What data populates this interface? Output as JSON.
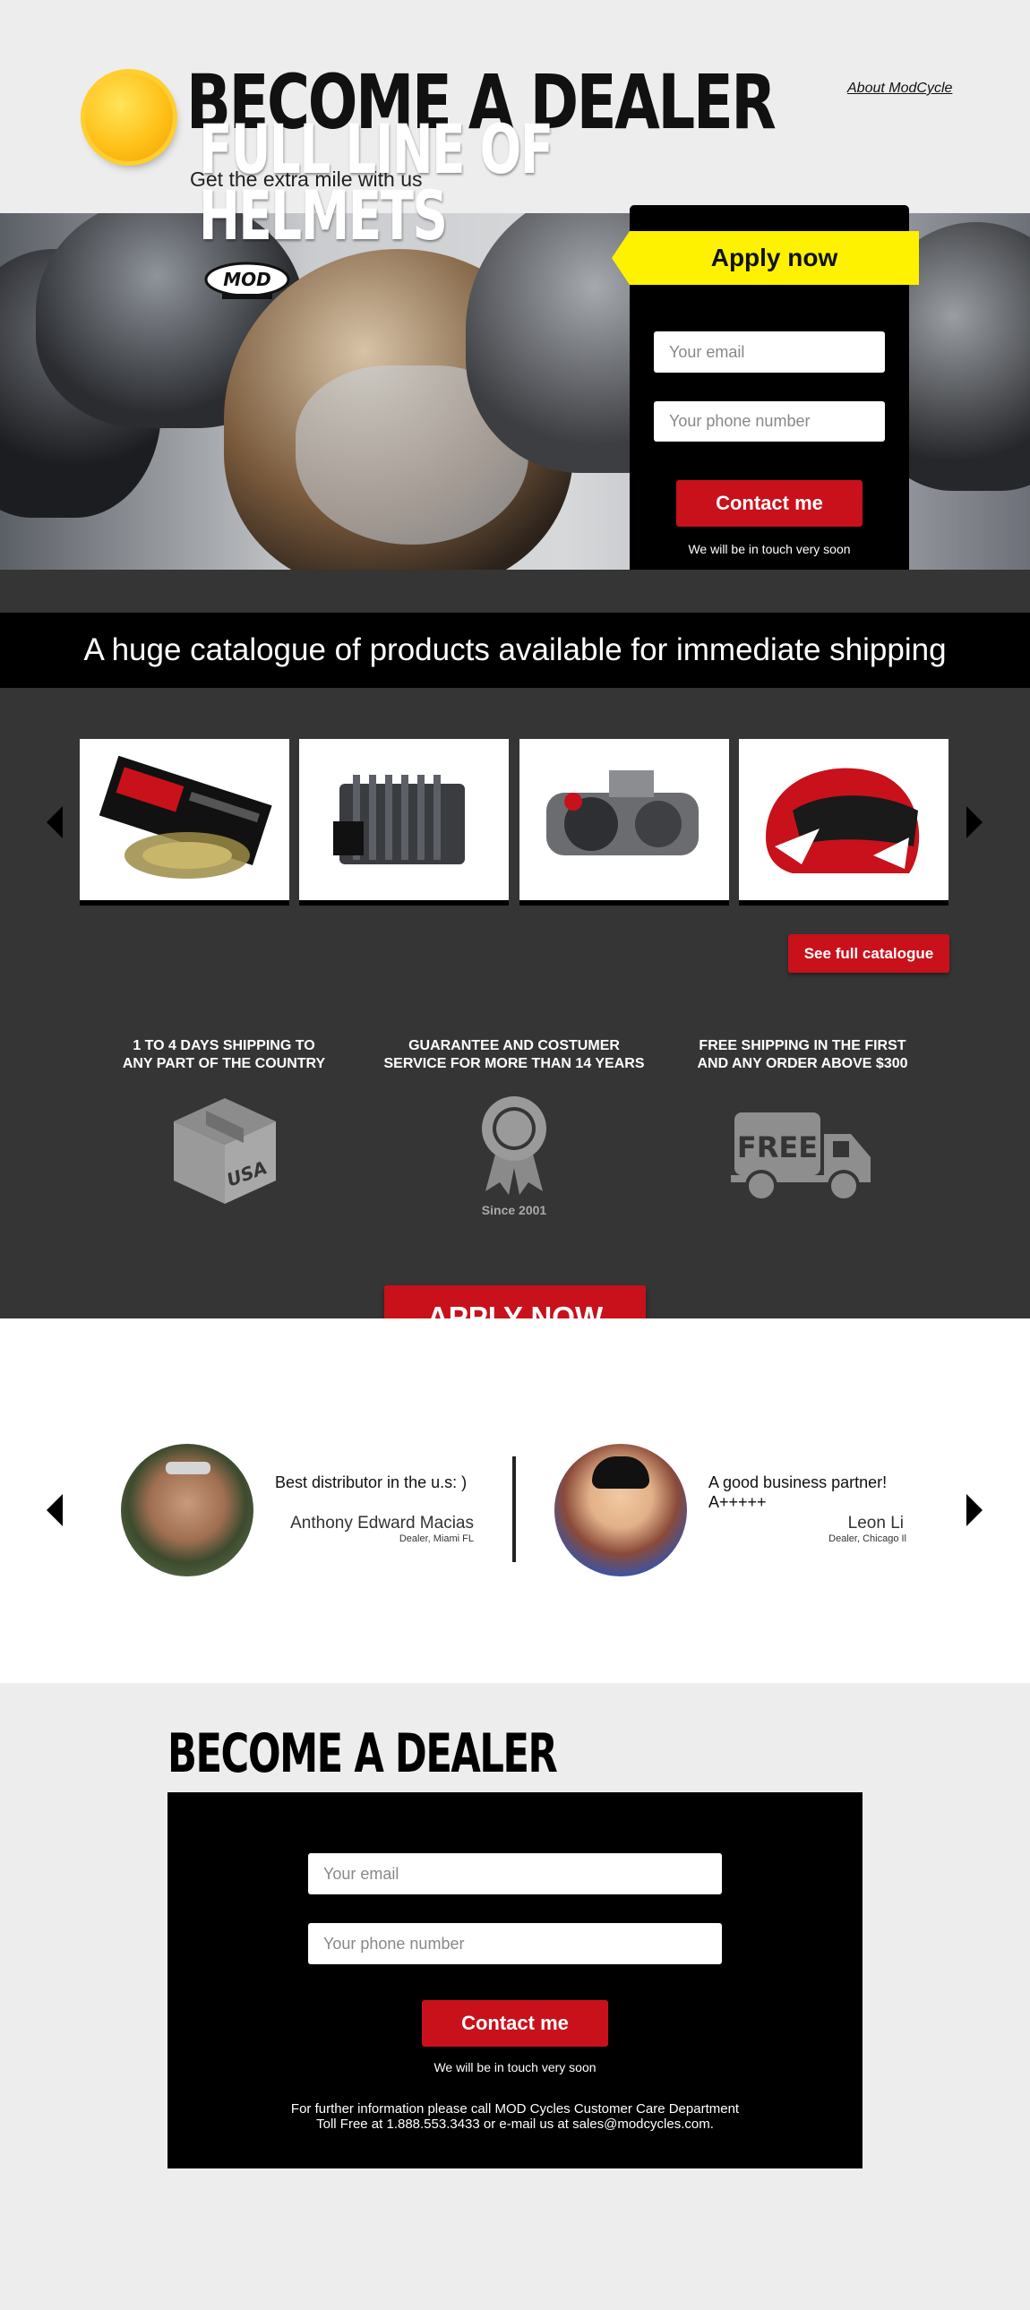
{
  "header": {
    "title": "BECOME A DEALER",
    "subtitle": "Get the extra mile with us",
    "about_link": "About ModCycle"
  },
  "hero": {
    "title_line1": "FULL LINE OF",
    "title_line2": "HELMETS",
    "logo_text": "MOD"
  },
  "apply_form": {
    "banner": "Apply now",
    "email_placeholder": "Your email",
    "phone_placeholder": "Your phone number",
    "submit_label": "Contact me",
    "note": "We will be in touch very soon"
  },
  "catalogue": {
    "strip_text": "A huge catalogue of products available for immediate shipping",
    "products": [
      {
        "name": "chain kit",
        "icon": "chain-kit"
      },
      {
        "name": "regulator rectifier",
        "icon": "regulator"
      },
      {
        "name": "engine",
        "icon": "engine"
      },
      {
        "name": "helmet",
        "icon": "helmet"
      }
    ],
    "see_full_label": "See full catalogue"
  },
  "features": [
    {
      "line1": "1 TO 4 DAYS SHIPPING TO",
      "line2": "ANY PART OF THE COUNTRY",
      "icon_text": "USA"
    },
    {
      "line1": "GUARANTEE AND COSTUMER",
      "line2": "SERVICE FOR MORE THAN 14 YEARS",
      "icon_text": "Since 2001"
    },
    {
      "line1": "FREE SHIPPING IN THE FIRST",
      "line2": "AND ANY ORDER ABOVE $300",
      "icon_text": "FREE"
    }
  ],
  "cta": {
    "apply_now": "APPLY NOW"
  },
  "testimonials": [
    {
      "quote": "Best distributor in the u.s: )",
      "name": "Anthony Edward Macias",
      "role": "Dealer, Miami FL"
    },
    {
      "quote": "A good business partner! A+++++",
      "name": "Leon Li",
      "role": "Dealer, Chicago Il"
    }
  ],
  "bottom": {
    "title": "BECOME A DEALER",
    "email_placeholder": "Your email",
    "phone_placeholder": "Your phone number",
    "submit_label": "Contact me",
    "note": "We will be in touch very soon",
    "further_line1": "For further information please call MOD Cycles Customer Care Department",
    "further_line2": "Toll Free at 1.888.553.3433 or e-mail us at sales@modcycles.com."
  },
  "colors": {
    "accent_red": "#c8111b",
    "accent_yellow": "#fff200",
    "dark": "#353535"
  }
}
